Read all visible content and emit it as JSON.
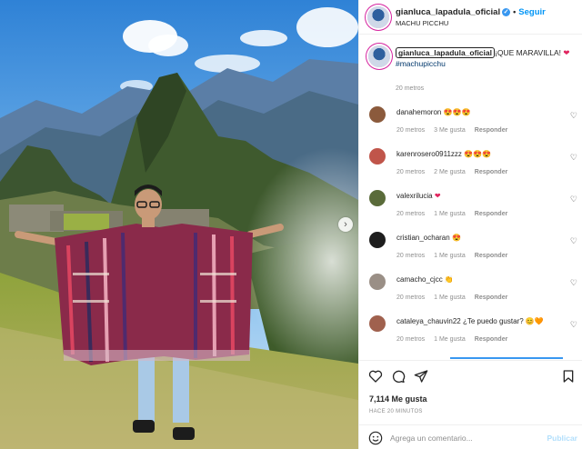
{
  "post": {
    "username": "gianluca_lapadula_oficial",
    "verified_icon": "verified-badge-icon",
    "separator": "•",
    "follow_label": "Seguir",
    "location": "MACHU PICCHU",
    "caption_text": "¡QUE MARAVILLA!",
    "caption_heart": "❤",
    "hashtag": "#machupicchu",
    "caption_time": "20 metros"
  },
  "comments": [
    {
      "user": "danahemoron",
      "text": "😍😍😍",
      "time": "20 metros",
      "likes": "3 Me gusta",
      "reply": "Responder",
      "avatar_color": "#8b5a3c"
    },
    {
      "user": "karenrosero0911zzz",
      "text": "😍😍😍",
      "time": "20 metros",
      "likes": "2 Me gusta",
      "reply": "Responder",
      "avatar_color": "#c0554a"
    },
    {
      "user": "valexrilucia",
      "text": "❤",
      "time": "20 metros",
      "likes": "1 Me gusta",
      "reply": "Responder",
      "avatar_color": "#5a6b3a"
    },
    {
      "user": "cristian_ocharan",
      "text": "😍",
      "time": "20 metros",
      "likes": "1 Me gusta",
      "reply": "Responder",
      "avatar_color": "#1e1e1e"
    },
    {
      "user": "camacho_cjcc",
      "text": "👏",
      "time": "20 metros",
      "likes": "1 Me gusta",
      "reply": "Responder",
      "avatar_color": "#9a8f86"
    },
    {
      "user": "cataleya_chauvin22",
      "text": "¿Te puedo gustar? 😊🧡",
      "time": "20 metros",
      "likes": "1 Me gusta",
      "reply": "Responder",
      "avatar_color": "#a0614e"
    }
  ],
  "actions": {
    "like_icon": "heart-icon",
    "comment_icon": "comment-icon",
    "share_icon": "share-icon",
    "save_icon": "bookmark-icon",
    "likes_count": "7,114 Me gusta",
    "time_ago": "HACE 20 MINUTOS"
  },
  "add_comment": {
    "emoji_icon": "smiley-icon",
    "placeholder": "Agrega un comentario...",
    "publish_label": "Publicar"
  },
  "photo": {
    "next_icon": "chevron-right-icon",
    "next_glyph": "›"
  },
  "colors": {
    "accent": "#0095f6",
    "verified": "#3897f0",
    "muted": "#8e8e8e",
    "like_red": "#e0245e"
  }
}
